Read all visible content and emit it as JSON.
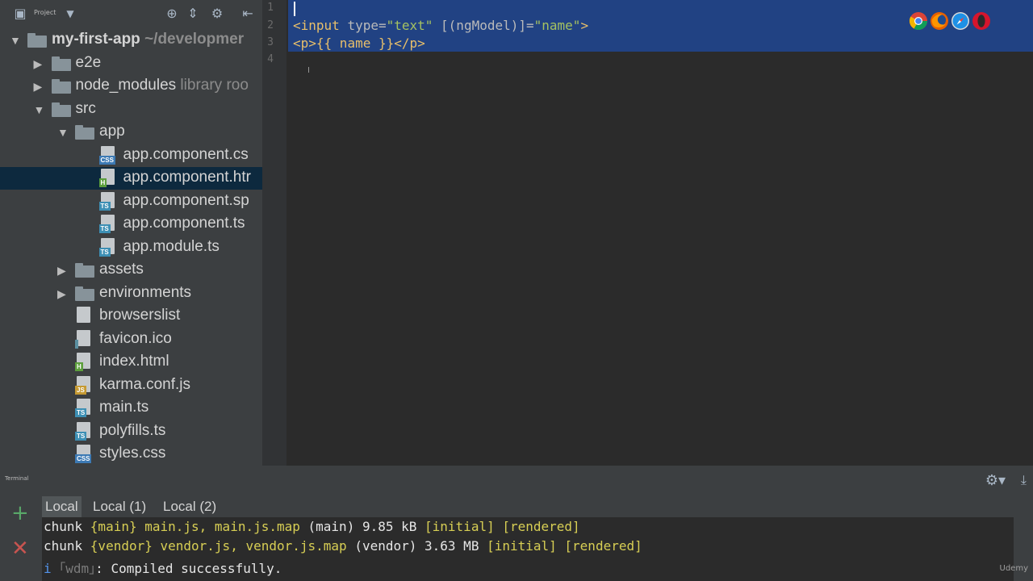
{
  "project_panel": {
    "label": "Project",
    "tree": [
      {
        "name": "my-first-app",
        "hint": " ~/developmer",
        "type": "folder",
        "depth": 0,
        "expanded": true
      },
      {
        "name": "e2e",
        "type": "folder",
        "depth": 1,
        "expanded": false
      },
      {
        "name": "node_modules",
        "hint": " library roo",
        "type": "folder",
        "depth": 1,
        "expanded": false
      },
      {
        "name": "src",
        "type": "folder",
        "depth": 1,
        "expanded": true
      },
      {
        "name": "app",
        "type": "folder",
        "depth": 2,
        "expanded": true
      },
      {
        "name": "app.component.cs",
        "type": "file",
        "badge": "CSS",
        "depth": 3
      },
      {
        "name": "app.component.htr",
        "type": "file",
        "badge": "H",
        "depth": 3,
        "selected": true
      },
      {
        "name": "app.component.sp",
        "type": "file",
        "badge": "TS",
        "depth": 3
      },
      {
        "name": "app.component.ts",
        "type": "file",
        "badge": "TS",
        "depth": 3
      },
      {
        "name": "app.module.ts",
        "type": "file",
        "badge": "TS",
        "depth": 3
      },
      {
        "name": "assets",
        "type": "folder",
        "depth": 2,
        "expanded": false
      },
      {
        "name": "environments",
        "type": "folder",
        "depth": 2,
        "expanded": false
      },
      {
        "name": "browserslist",
        "type": "file",
        "badge": "",
        "depth": 2
      },
      {
        "name": "favicon.ico",
        "type": "file",
        "badge": "IMG",
        "depth": 2
      },
      {
        "name": "index.html",
        "type": "file",
        "badge": "H",
        "depth": 2
      },
      {
        "name": "karma.conf.js",
        "type": "file",
        "badge": "JS",
        "depth": 2
      },
      {
        "name": "main.ts",
        "type": "file",
        "badge": "TS",
        "depth": 2
      },
      {
        "name": "polyfills.ts",
        "type": "file",
        "badge": "TS",
        "depth": 2
      },
      {
        "name": "styles.css",
        "type": "file",
        "badge": "CSS",
        "depth": 2
      }
    ]
  },
  "editor": {
    "line_numbers": [
      "1",
      "2",
      "3",
      "4"
    ],
    "line2": {
      "open": "<input ",
      "attr1": "type=",
      "val1": "\"text\"",
      "attr2": " [(ngModel)]=",
      "val2": "\"name\"",
      "close": ">"
    },
    "line3": {
      "open": "<p>",
      "text": "{{ name }}",
      "close": "</p>"
    }
  },
  "terminal": {
    "title": "Terminal",
    "tabs": [
      "Local",
      "Local (1)",
      "Local (2)"
    ],
    "active_tab": 0,
    "lines": [
      {
        "a": "chunk ",
        "b": "{main}",
        "c": " main.js, main.js.map",
        "d": " (main) 9.85 kB ",
        "e": "[initial] [rendered]"
      },
      {
        "a": "chunk ",
        "b": "{vendor}",
        "c": " vendor.js, vendor.js.map",
        "d": " (vendor) 3.63 MB ",
        "e": "[initial] [rendered]"
      }
    ],
    "status_prefix": "i ",
    "status_tag": "｢wdm｣",
    "status_text": ": Compiled successfully.",
    "watermark": "Udemy"
  },
  "colors": {
    "folder": "#87939a",
    "badge_css": "#3d7ab4",
    "badge_html": "#5c9e3c",
    "badge_ts": "#3d8fb4",
    "badge_js": "#c69a33",
    "badge_img": "#5b8fa0",
    "selection": "#214283"
  }
}
